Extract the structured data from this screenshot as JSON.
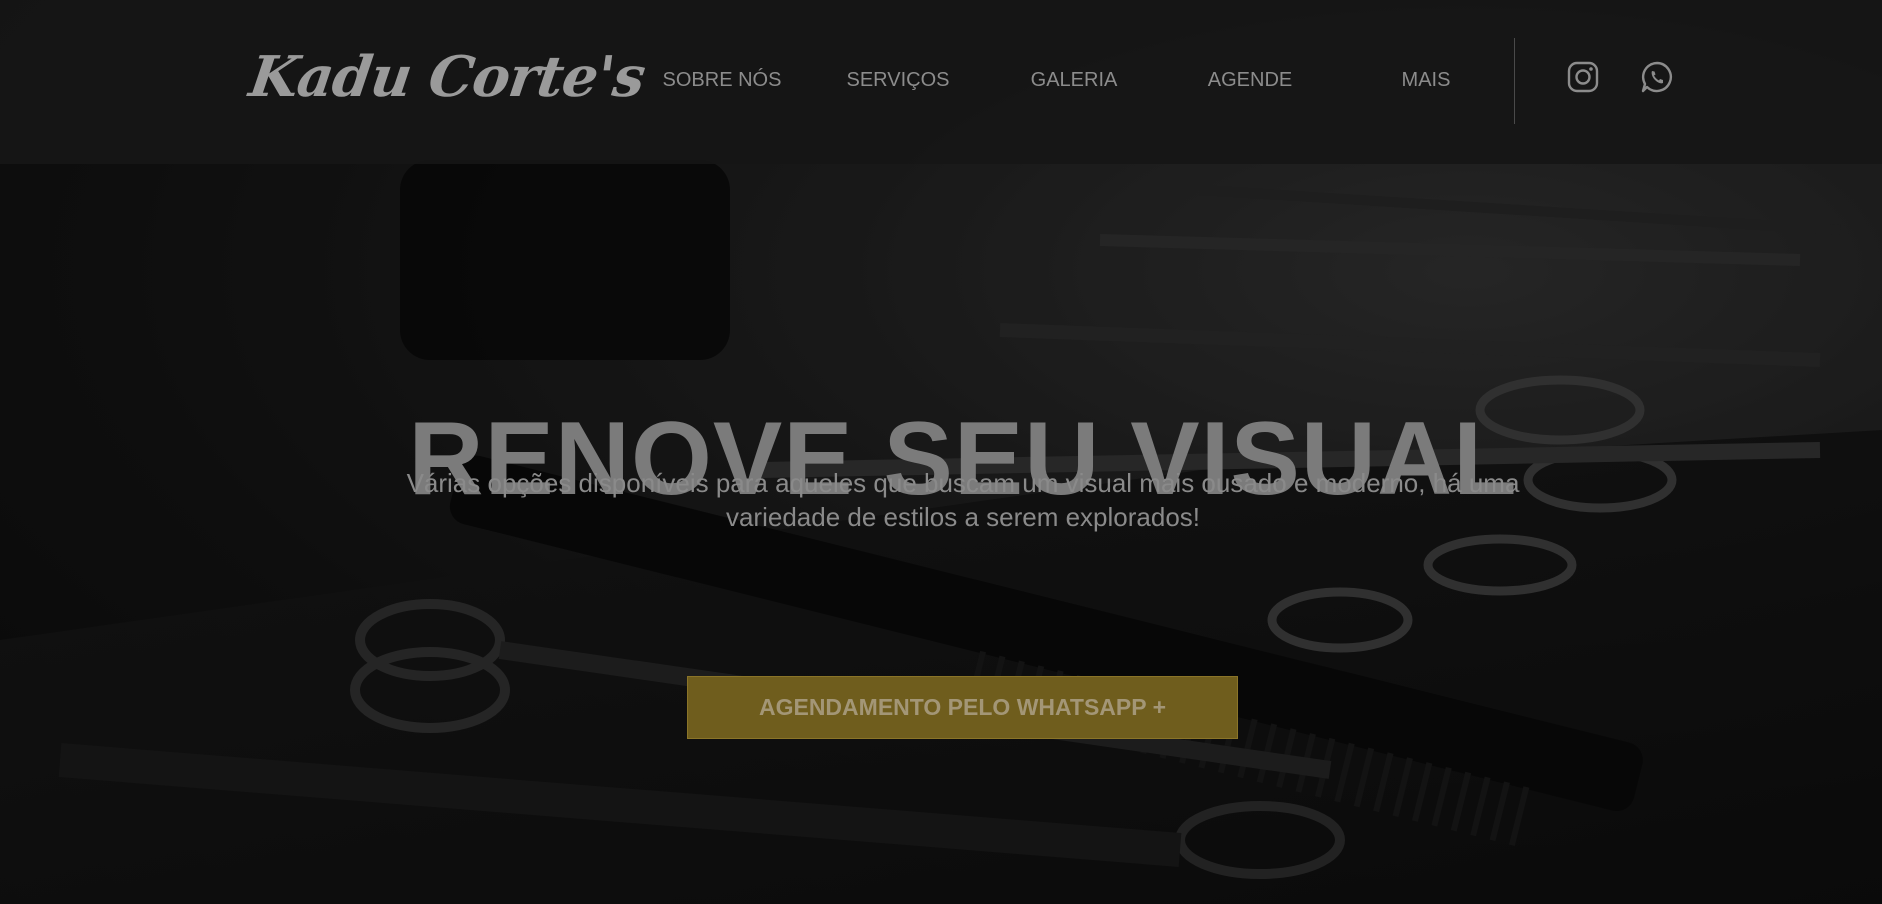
{
  "header": {
    "logo_text": "Kadu Corte's",
    "nav": [
      {
        "label": "SOBRE NÓS"
      },
      {
        "label": "SERVIÇOS"
      },
      {
        "label": "GALERIA"
      },
      {
        "label": "AGENDE"
      },
      {
        "label": "MAIS"
      }
    ],
    "social": [
      {
        "icon": "instagram-icon"
      },
      {
        "icon": "whatsapp-icon"
      }
    ]
  },
  "hero": {
    "title": "RENOVE SEU VISUAL",
    "subtitle": "Várias opções disponíveis para aqueles que buscam um visual mais ousado e moderno, há uma variedade de estilos a serem explorados!",
    "cta_label": "AGENDAMENTO PELO WHATSAPP +"
  },
  "colors": {
    "header_bg": "#161616",
    "text_muted": "#8c8c8c",
    "title": "#7b7b7b",
    "cta_bg": "#6f5d1d",
    "cta_text": "#a39676"
  }
}
